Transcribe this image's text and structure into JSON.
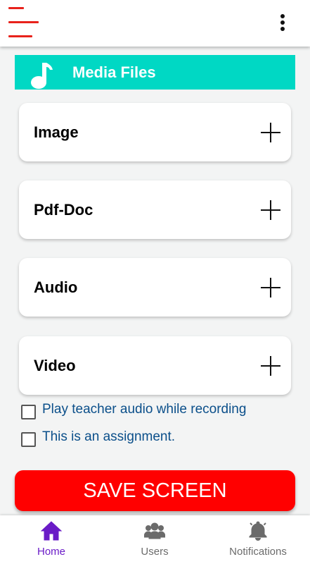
{
  "colors": {
    "accent": "#e8221b",
    "header_teal": "#00d8c4",
    "save_red": "#ff0000",
    "link_blue": "#0b4f8a",
    "nav_active": "#6a1bc7",
    "nav_inactive": "#6b6b6b"
  },
  "appbar": {
    "menu_icon": "hamburger-menu-icon",
    "overflow_icon": "more-vert-icon"
  },
  "section": {
    "icon": "music-note-icon",
    "title": "Media Files"
  },
  "media_items": [
    {
      "label": "Image",
      "action_icon": "plus-icon"
    },
    {
      "label": "Pdf-Doc",
      "action_icon": "plus-icon"
    },
    {
      "label": "Audio",
      "action_icon": "plus-icon"
    },
    {
      "label": "Video",
      "action_icon": "plus-icon"
    }
  ],
  "options": [
    {
      "label": "Play teacher audio while recording",
      "checked": false
    },
    {
      "label": "This is an assignment.",
      "checked": false
    }
  ],
  "save_button": {
    "label": "SAVE SCREEN"
  },
  "bottom_nav": [
    {
      "label": "Home",
      "icon": "home-icon",
      "active": true
    },
    {
      "label": "Users",
      "icon": "users-icon",
      "active": false
    },
    {
      "label": "Notifications",
      "icon": "bell-icon",
      "active": false
    }
  ]
}
